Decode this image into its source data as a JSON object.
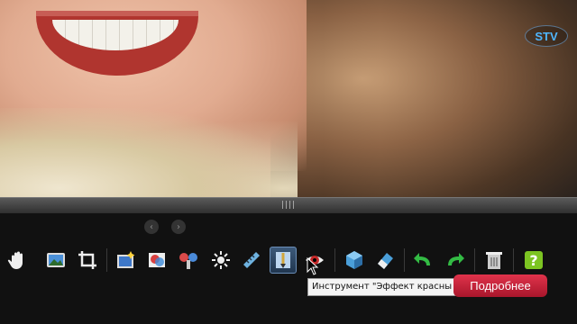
{
  "watermark": {
    "text": "STV"
  },
  "splitter": {
    "grip": "||||"
  },
  "toolbar": {
    "tools": [
      {
        "icon": "hand-icon",
        "selected": false
      },
      {
        "icon": "image-icon",
        "selected": false
      },
      {
        "icon": "crop-icon",
        "selected": false
      },
      {
        "icon": "enhance-icon",
        "selected": false
      },
      {
        "icon": "color-icon",
        "selected": false
      },
      {
        "icon": "retouch-icon",
        "selected": false
      },
      {
        "icon": "brightness-icon",
        "selected": false
      },
      {
        "icon": "straighten-icon",
        "selected": false
      },
      {
        "icon": "brush-icon",
        "selected": true
      },
      {
        "icon": "red-eye-icon",
        "selected": false
      },
      {
        "icon": "cube-icon",
        "selected": false
      },
      {
        "icon": "eraser-icon",
        "selected": false
      },
      {
        "icon": "rotate-left-icon",
        "selected": false
      },
      {
        "icon": "rotate-right-icon",
        "selected": false
      },
      {
        "icon": "trash-icon",
        "selected": false
      },
      {
        "icon": "help-icon",
        "selected": false
      }
    ]
  },
  "tooltip": {
    "text": "Инструмент \"Эффект красны"
  },
  "more_button": {
    "label": "Подробнее"
  }
}
